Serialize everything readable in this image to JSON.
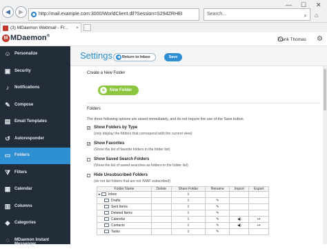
{
  "browser": {
    "url": "http://mail.example.com:3000/WorldClient.dll?Session=S294ZRHEI",
    "search_placeholder": "Search...",
    "tab_title": "(3) MDaemon Webmail - Fr...",
    "tab_close": "×",
    "win_min": "—",
    "win_max": "☐",
    "win_close": "✕"
  },
  "app": {
    "logo_text": "MDaemon",
    "logo_reg": "®",
    "user_name": "Frank Thomas"
  },
  "sidebar": {
    "items": [
      {
        "label": "Personalize",
        "icon": "person-icon"
      },
      {
        "label": "Security",
        "icon": "lock-icon"
      },
      {
        "label": "Notifications",
        "icon": "bell-icon"
      },
      {
        "label": "Compose",
        "icon": "pencil-icon"
      },
      {
        "label": "Email Templates",
        "icon": "template-icon"
      },
      {
        "label": "Autoresponder",
        "icon": "reply-icon"
      },
      {
        "label": "Folders",
        "icon": "folder-icon"
      },
      {
        "label": "Filters",
        "icon": "filter-icon"
      },
      {
        "label": "Calendar",
        "icon": "calendar-icon"
      },
      {
        "label": "Columns",
        "icon": "columns-icon"
      },
      {
        "label": "Categories",
        "icon": "tag-icon"
      },
      {
        "label": "MDaemon Instant Messenger",
        "icon": "chat-icon"
      }
    ],
    "active_index": 6
  },
  "header": {
    "title": "Settings",
    "return_label": "Return to Inbox",
    "save_label": "Save"
  },
  "content": {
    "create_heading": "Create a New Folder",
    "new_folder_label": "New Folder",
    "folders_heading": "Folders",
    "folders_desc": "The three following options are saved immediately, and do not require the use of the Save button.",
    "options": [
      {
        "label": "Show Folders by Type",
        "sub": "(only display the folders that correspond with the current view)",
        "checked": true
      },
      {
        "label": "Show Favorites",
        "sub": "(Show the list of favorite folders in the folder list)",
        "checked": true
      },
      {
        "label": "Show Saved Search Folders",
        "sub": "(Show the list of saved searches as folders in the folder list)",
        "checked": false
      },
      {
        "label": "Hide Unsubscribed Folders",
        "sub": "(do not list folders that are not IMAP subscribed)",
        "checked": false
      }
    ],
    "table": {
      "headers": [
        "Folder Name",
        "Delete",
        "Share Folder",
        "Rename",
        "Import",
        "Export"
      ],
      "rows": [
        {
          "name": "Inbox",
          "share": true,
          "rename": false,
          "import": false,
          "export": false
        },
        {
          "name": "Drafts",
          "share": true,
          "rename": true,
          "import": false,
          "export": false
        },
        {
          "name": "Sent Items",
          "share": true,
          "rename": true,
          "import": false,
          "export": false
        },
        {
          "name": "Deleted Items",
          "share": true,
          "rename": true,
          "import": false,
          "export": false
        },
        {
          "name": "Calendar",
          "share": true,
          "rename": true,
          "import": true,
          "export": true
        },
        {
          "name": "Contacts",
          "share": true,
          "rename": true,
          "import": true,
          "export": true
        },
        {
          "name": "Tasks",
          "share": true,
          "rename": true,
          "import": false,
          "export": false
        }
      ]
    }
  }
}
